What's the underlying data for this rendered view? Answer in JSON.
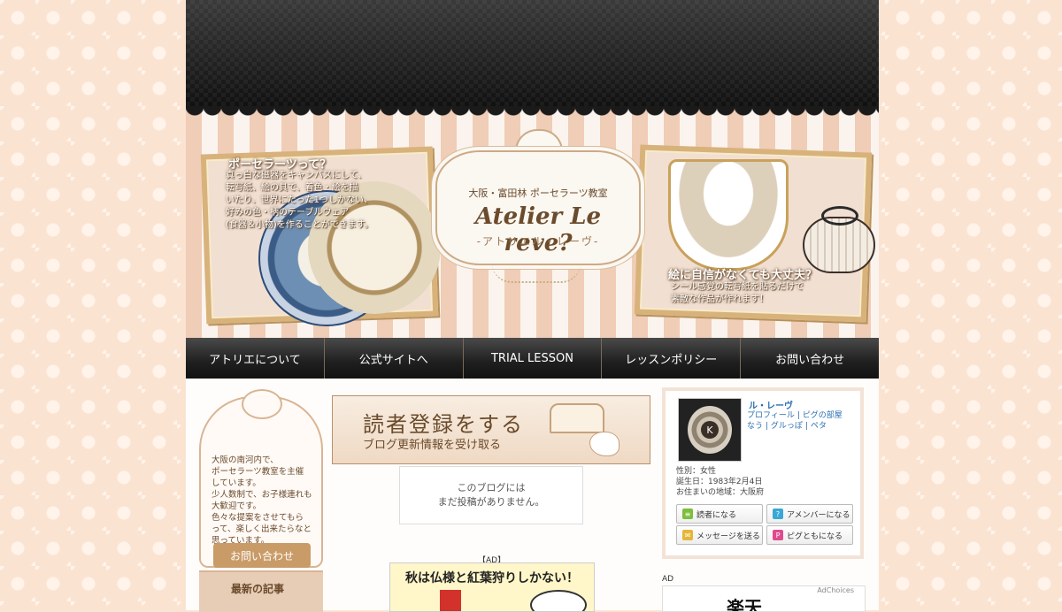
{
  "nav": {
    "items": [
      "アトリエについて",
      "公式サイトへ",
      "TRIAL LESSON",
      "レッスンポリシー",
      "お問い合わせ"
    ]
  },
  "header": {
    "left_title": "ポーセラーツって？",
    "left_text": "真っ白な磁器をキャンバスにして、\n転写紙、絵の具で、着色・絵を描\nいたり、世界にたった1つしかない、\n好みの色・柄のテーブルウェア\n(食器＆小物)を作ることができます。",
    "right_title": "絵に自信がなくても大丈夫？",
    "right_text": "シール感覚の転写紙を貼るだけで\n素敵な作品が作れます！",
    "logo_sub": "大阪・富田林 ポーセラーツ教室",
    "logo_name": "Atelier Le reve?",
    "logo_kana": "-アトリエル・レーヴ-"
  },
  "sidebar_left": {
    "intro": "大阪の南河内で、\nポーセラーツ教室を主催\nしています。\n少人数制で、お子様連れも\n大歓迎です。\n色々な提案をさせてもら\nって、楽しく出来たらなと\n思っています。",
    "contact_button": "お問い合わせ",
    "latest_title": "最新の記事"
  },
  "center": {
    "reader_title": "読者登録をする",
    "reader_sub": "ブログ更新情報を受け取る",
    "empty_message": "このブログには\nまだ投稿がありません。",
    "ad_label": "【AD】",
    "ad_text": "秋は仏様と紅葉狩りしかない！"
  },
  "profile": {
    "name": "ル・レーヴ",
    "links": [
      "プロフィール",
      "ピグの部屋",
      "なう",
      "グルっぽ",
      "ペタ"
    ],
    "avatar_letter": "K",
    "gender": "性別：女性",
    "birthday": "誕生日：1983年2月4日",
    "residence": "お住まいの地域：大阪府",
    "buttons": {
      "reader": "読者になる",
      "amember": "アメンバーになる",
      "message": "メッセージを送る",
      "pigtomo": "ピグともになる"
    }
  },
  "ad_right": {
    "label": "AD",
    "adchoices": "AdChoices",
    "brand": "楽天"
  },
  "colors": {
    "nav_bg": "#1f1f1f",
    "accent": "#c99b67",
    "link": "#2a6fb2"
  }
}
